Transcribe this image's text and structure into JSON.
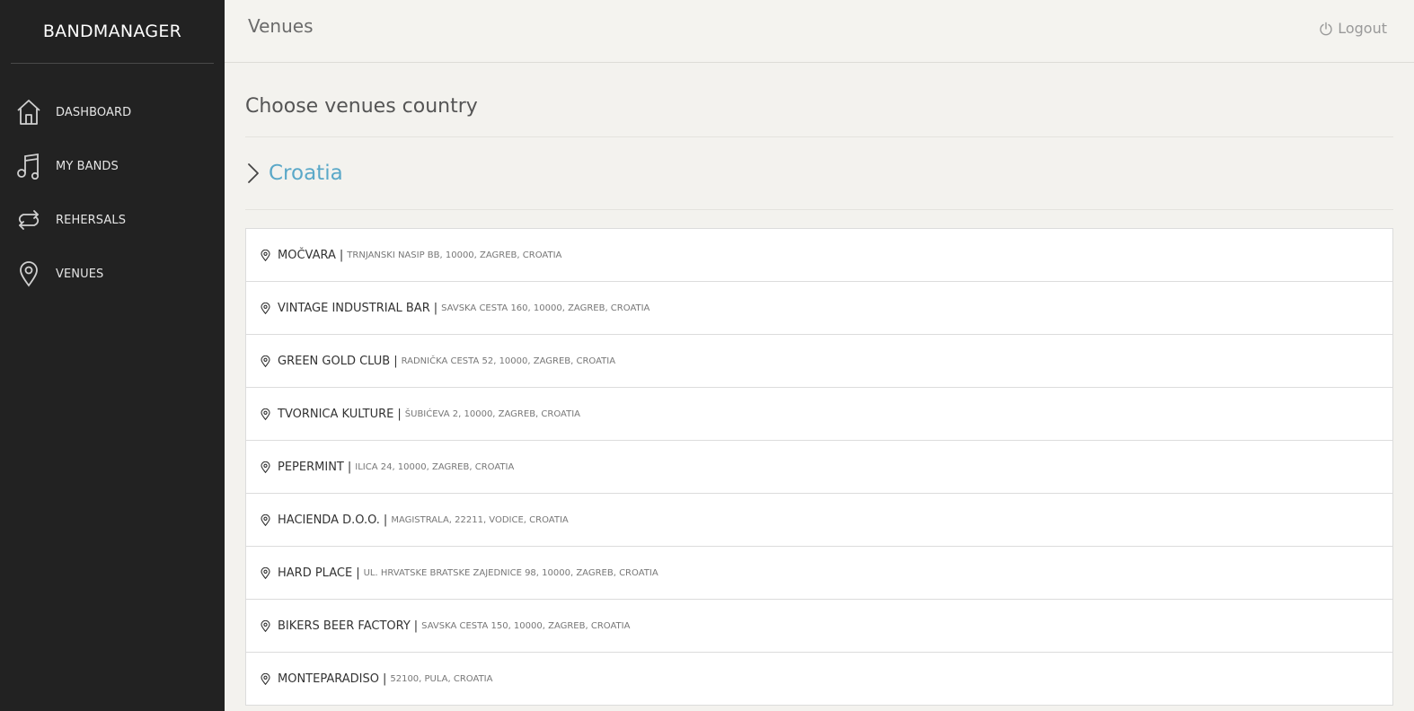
{
  "sidebar": {
    "brand": "BANDMANAGER",
    "items": [
      {
        "label": "DASHBOARD",
        "icon": "home-icon"
      },
      {
        "label": "MY BANDS",
        "icon": "music-note-icon"
      },
      {
        "label": "REHERSALS",
        "icon": "repeat-icon"
      },
      {
        "label": "VENUES",
        "icon": "map-pin-icon"
      }
    ]
  },
  "header": {
    "title": "Venues",
    "logout_label": "Logout"
  },
  "main": {
    "section_title": "Choose venues country",
    "country": "Croatia",
    "separator": "|",
    "venues": [
      {
        "name": "MOČVARA",
        "address": "TRNJANSKI NASIP BB, 10000, ZAGREB, CROATIA"
      },
      {
        "name": "VINTAGE INDUSTRIAL BAR",
        "address": "SAVSKA CESTA 160, 10000, ZAGREB, CROATIA"
      },
      {
        "name": "GREEN GOLD CLUB",
        "address": "RADNIČKA CESTA 52, 10000, ZAGREB, CROATIA"
      },
      {
        "name": "TVORNICA KULTURE",
        "address": "ŠUBIĆEVA 2, 10000, ZAGREB, CROATIA"
      },
      {
        "name": "PEPERMINT",
        "address": "ILICA 24, 10000, ZAGREB, CROATIA"
      },
      {
        "name": "HACIENDA D.O.O.",
        "address": "MAGISTRALA, 22211, VODICE, CROATIA"
      },
      {
        "name": "HARD PLACE",
        "address": "UL. HRVATSKE BRATSKE ZAJEDNICE 98, 10000, ZAGREB, CROATIA"
      },
      {
        "name": "BIKERS BEER FACTORY",
        "address": "SAVSKA CESTA 150, 10000, ZAGREB, CROATIA"
      },
      {
        "name": "MONTEPARADISO",
        "address": "52100, PULA, CROATIA"
      }
    ]
  },
  "colors": {
    "sidebar_bg": "#222222",
    "country_link": "#5aa8c8",
    "page_bg": "#f3f2ee"
  }
}
